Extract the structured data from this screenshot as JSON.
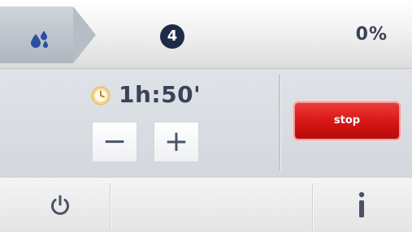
{
  "header": {
    "mode_icon": "water-drops-icon",
    "step_number": "4",
    "progress": "0%"
  },
  "timer": {
    "icon": "clock-icon",
    "value": "1h:50'"
  },
  "controls": {
    "decrease_label": "−",
    "increase_label": "+",
    "stop_label": "stop"
  },
  "footer": {
    "power_icon": "power-icon",
    "info_icon": "info-icon"
  },
  "colors": {
    "badge": "#1f2b47",
    "stop_button": "#d61414",
    "text_dark": "#3a4256",
    "accent_blue": "#2c4fa3"
  }
}
